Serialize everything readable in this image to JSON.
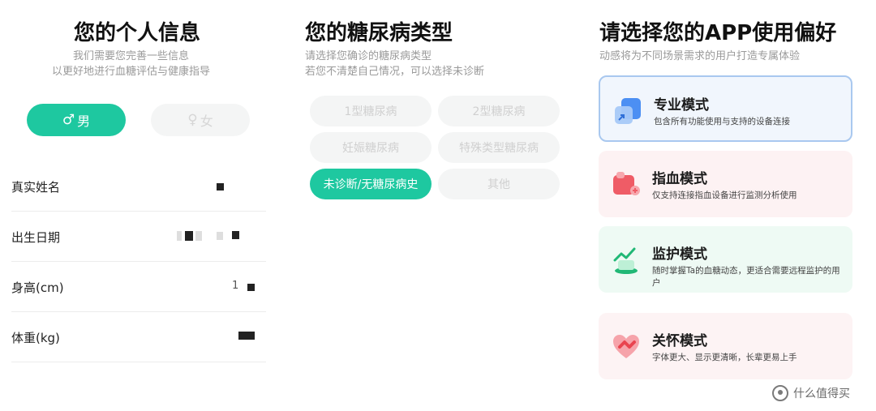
{
  "personal": {
    "title": "您的个人信息",
    "subtitle_line1": "我们需要您完善一些信息",
    "subtitle_line2": "以更好地进行血糖评估与健康指导",
    "gender_male": "男",
    "gender_female": "女",
    "selected_gender": "男",
    "fields": [
      {
        "label": "真实姓名"
      },
      {
        "label": "出生日期"
      },
      {
        "label": "身高(cm)",
        "value_visible": "1"
      },
      {
        "label": "体重(kg)"
      }
    ]
  },
  "diabetes": {
    "title": "您的糖尿病类型",
    "subtitle_line1": "请选择您确诊的糖尿病类型",
    "subtitle_line2": "若您不清楚自己情况，可以选择未诊断",
    "options": [
      "1型糖尿病",
      "2型糖尿病",
      "妊娠糖尿病",
      "特殊类型糖尿病",
      "未诊断/无糖尿病史",
      "其他"
    ],
    "selected": "未诊断/无糖尿病史"
  },
  "preference": {
    "title": "请选择您的APP使用偏好",
    "subtitle": "动感将为不同场景需求的用户打造专属体验",
    "modes": [
      {
        "title": "专业模式",
        "desc": "包含所有功能使用与支持的设备连接",
        "icon": "professional-icon"
      },
      {
        "title": "指血模式",
        "desc": "仅支持连接指血设备进行监测分析使用",
        "icon": "finger-blood-icon"
      },
      {
        "title": "监护模式",
        "desc": "随时掌握Ta的血糖动态，更适合需要远程监护的用户",
        "icon": "monitor-icon"
      },
      {
        "title": "关怀模式",
        "desc": "字体更大、显示更清晰，长辈更易上手",
        "icon": "care-icon"
      }
    ],
    "selected": "专业模式"
  },
  "watermark": {
    "text": "什么值得买"
  },
  "colors": {
    "accent": "#1ec8a0",
    "selected_border": "#a9c8ef"
  }
}
